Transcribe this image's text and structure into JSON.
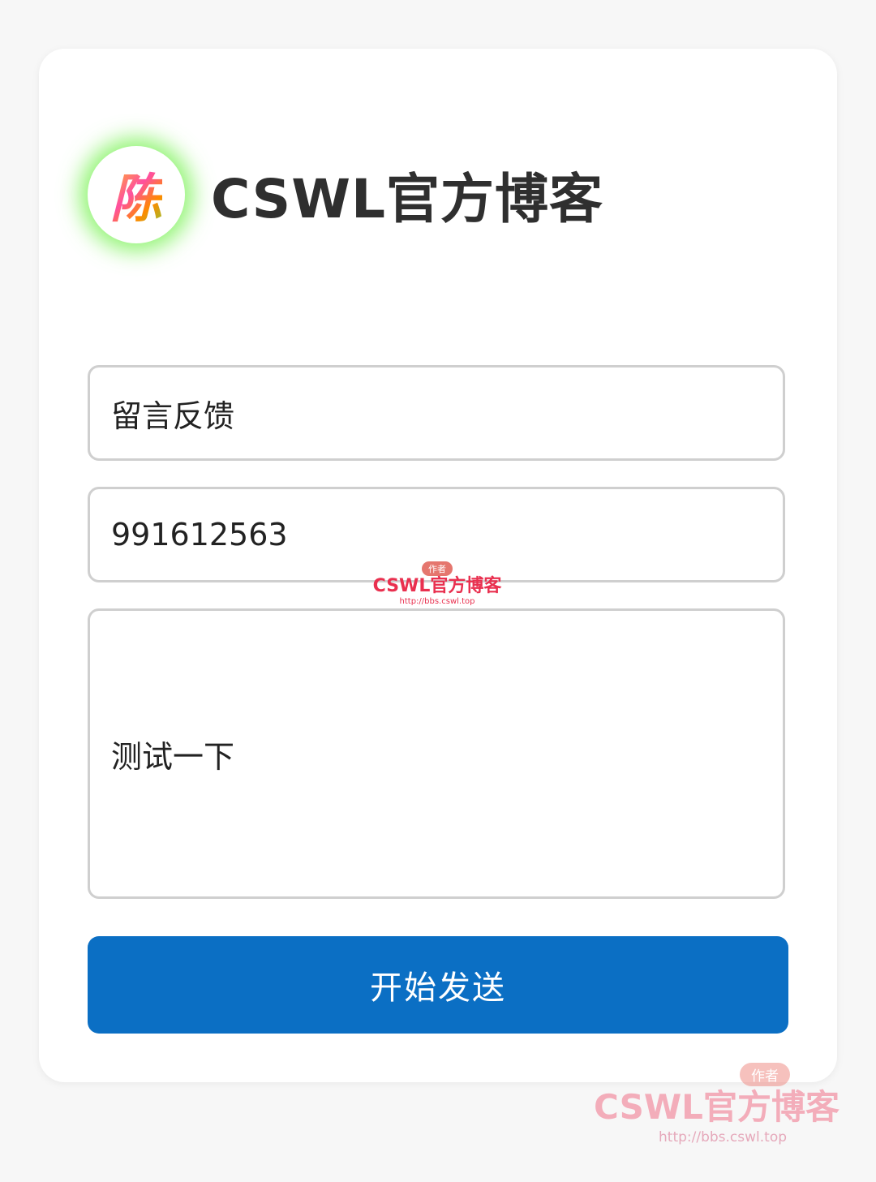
{
  "header": {
    "avatar_glyph": "陈",
    "site_title": "CSWL官方博客"
  },
  "form": {
    "subject_value": "留言反馈",
    "contact_value": "991612563",
    "message_value": "测试一下",
    "send_label": "开始发送"
  },
  "watermark": {
    "badge": "作者",
    "title": "CSWL官方博客",
    "url": "http://bbs.cswl.top"
  },
  "colors": {
    "primary_button": "#0b6fc4",
    "avatar_glow": "#6ef046",
    "watermark": "#e9304f"
  }
}
